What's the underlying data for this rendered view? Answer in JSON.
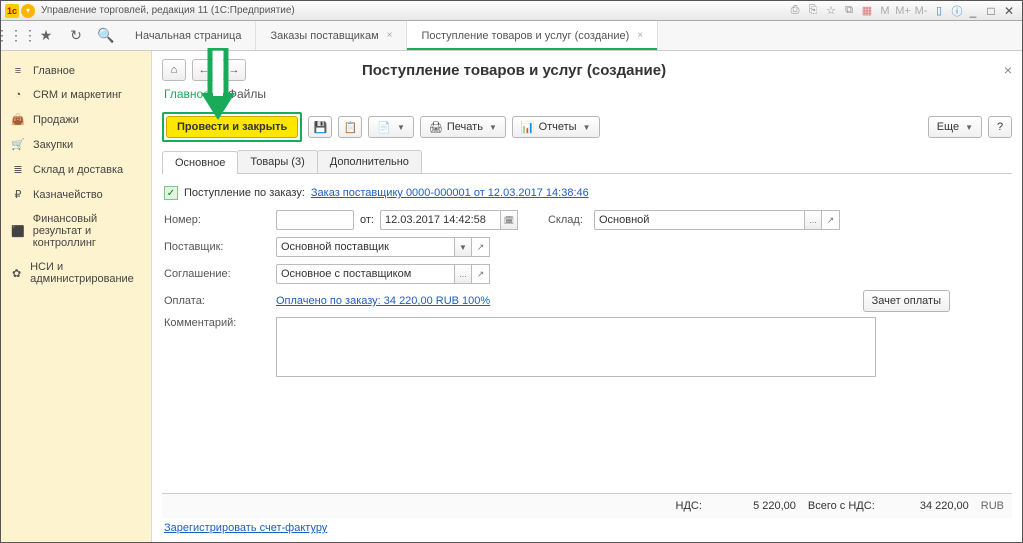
{
  "window": {
    "title": "Управление торговлей, редакция 11  (1С:Предприятие)"
  },
  "topTabs": {
    "t0": "Начальная страница",
    "t1": "Заказы поставщикам",
    "t2": "Поступление товаров и услуг (создание)"
  },
  "sidebar": {
    "items": [
      {
        "icon": "≡",
        "label": "Главное"
      },
      {
        "icon": "◔",
        "label": "CRM и маркетинг"
      },
      {
        "icon": "👜",
        "label": "Продажи"
      },
      {
        "icon": "🛒",
        "label": "Закупки"
      },
      {
        "icon": "≣",
        "label": "Склад и доставка"
      },
      {
        "icon": "₽",
        "label": "Казначейство"
      },
      {
        "icon": "⬛",
        "label": "Финансовый результат и контроллинг"
      },
      {
        "icon": "✿",
        "label": "НСИ и администрирование"
      }
    ]
  },
  "page": {
    "title": "Поступление товаров и услуг (создание)",
    "subtabs": {
      "main": "Главное",
      "files": "Файлы"
    },
    "post_close": "Провести и закрыть",
    "print": "Печать",
    "reports": "Отчеты",
    "more": "Еще",
    "formTabs": {
      "osn": "Основное",
      "tov": "Товары (3)",
      "dop": "Дополнительно"
    },
    "order_check_label": "Поступление по заказу:",
    "order_link": "Заказ поставщику 0000-000001 от 12.03.2017 14:38:46",
    "number_label": "Номер:",
    "number": "",
    "ot": "от:",
    "date": "12.03.2017 14:42:58",
    "sklad_label": "Склад:",
    "sklad": "Основной",
    "supplier_label": "Поставщик:",
    "supplier": "Основной поставщик",
    "agree_label": "Соглашение:",
    "agree": "Основное с поставщиком",
    "pay_label": "Оплата:",
    "pay_link": "Оплачено по заказу: 34 220,00 RUB  100%",
    "offset": "Зачет оплаты",
    "comment_label": "Комментарий:",
    "comment": ""
  },
  "footer": {
    "nds_label": "НДС:",
    "nds": "5 220,00",
    "total_label": "Всего с НДС:",
    "total": "34 220,00",
    "cur": "RUB"
  },
  "reg_link": "Зарегистрировать счет-фактуру"
}
